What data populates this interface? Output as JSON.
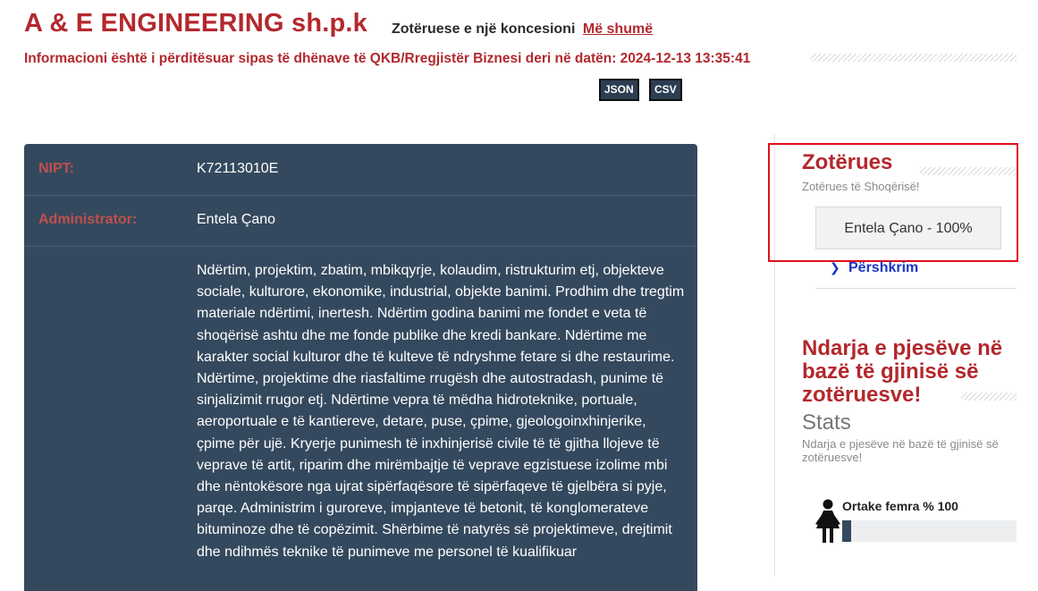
{
  "company": {
    "name": "A & E ENGINEERING sh.p.k",
    "concession_text": "Zotëruese e një koncesioni",
    "concession_link": "Më shumë",
    "update_notice": "Informacioni është i përditësuar sipas të dhënave të QKB/Rregjistër Biznesi deri në datën: 2024-12-13 13:35:41"
  },
  "export": {
    "json_label": "JSON",
    "csv_label": "CSV"
  },
  "details": {
    "nipt_label": "NIPT:",
    "nipt_value": "K72113010E",
    "admin_label": "Administrator:",
    "admin_value": "Entela Çano",
    "description": "Ndërtim, projektim, zbatim, mbikqyrje, kolaudim, ristrukturim etj, objekteve sociale, kulturore, ekonomike, industrial, objekte banimi. Prodhim dhe tregtim materiale ndërtimi, inertesh. Ndërtim godina banimi me fondet e veta të shoqërisë ashtu dhe me fonde publike dhe kredi bankare. Ndërtime me karakter social kulturor dhe të kulteve të ndryshme fetare si dhe restaurime. Ndërtime, projektime dhe riasfaltime rrugësh dhe autostradash, punime të sinjalizimit rrugor etj. Ndërtime vepra të mëdha hidroteknike, portuale, aeroportuale e të kantiereve, detare, puse, çpime, gjeologoinxhinjerike, çpime për ujë. Kryerje punimesh të inxhinjerisë civile të të gjitha llojeve të veprave të artit, riparim dhe mirëmbajtje të veprave egzistuese izolime mbi dhe nëntokësore nga ujrat sipërfaqësore të sipërfaqeve të gjelbëra si pyje, parqe. Administrim i guroreve, impjanteve të betonit, të konglomerateve bituminoze dhe të copëzimit. Shërbime të natyrës së projektimeve, drejtimit dhe ndihmës teknike të punimeve me personel të kualifikuar"
  },
  "owners": {
    "heading": "Zotërues",
    "subheading": "Zotërues të Shoqërisë!",
    "items": [
      "Entela Çano - 100%"
    ],
    "description_link": "Përshkrim"
  },
  "gender_stats": {
    "heading": "Ndarja e pjesëve në bazë të gjinisë së zotëruesve!",
    "stats_title": "Stats",
    "subheading": "Ndarja e pjesëve në bazë të gjinisë së zotëruesve!",
    "female_label": "Ortake femra % 100",
    "female_fill_fraction": 0.05
  },
  "colors": {
    "brand_red": "#b3282d",
    "panel_bg": "#34495e",
    "highlight_border": "#e0101a",
    "link_blue": "#1a37c7"
  },
  "icons": {
    "female": "female-person-icon",
    "chevron": "chevron-right-icon"
  }
}
